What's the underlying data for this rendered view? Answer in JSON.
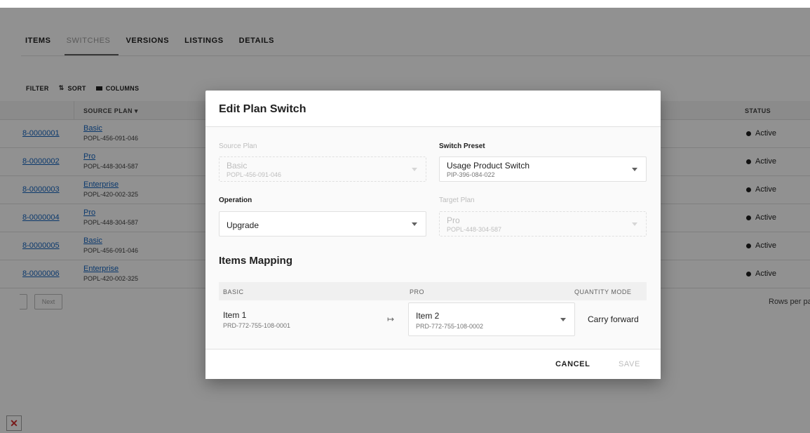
{
  "tabs": [
    {
      "label": "ITEMS",
      "active": false
    },
    {
      "label": "SWITCHES",
      "active": true
    },
    {
      "label": "VERSIONS",
      "active": false
    },
    {
      "label": "LISTINGS",
      "active": false
    },
    {
      "label": "DETAILS",
      "active": false
    }
  ],
  "toolbar": {
    "filter_label": "FILTER",
    "sort_label": "SORT",
    "sort_icon": "⇅",
    "columns_label": "COLUMNS"
  },
  "table": {
    "headers": {
      "source_plan": "SOURCE PLAN",
      "sort_arrow": "▾",
      "status": "STATUS"
    },
    "rows": [
      {
        "id": "8-0000001",
        "plan": "Basic",
        "plan_id": "POPL-456-091-046",
        "status": "Active"
      },
      {
        "id": "8-0000002",
        "plan": "Pro",
        "plan_id": "POPL-448-304-587",
        "status": "Active"
      },
      {
        "id": "8-0000003",
        "plan": "Enterprise",
        "plan_id": "POPL-420-002-325",
        "status": "Active"
      },
      {
        "id": "8-0000004",
        "plan": "Pro",
        "plan_id": "POPL-448-304-587",
        "status": "Active"
      },
      {
        "id": "8-0000005",
        "plan": "Basic",
        "plan_id": "POPL-456-091-046",
        "status": "Active"
      },
      {
        "id": "8-0000006",
        "plan": "Enterprise",
        "plan_id": "POPL-420-002-325",
        "status": "Active"
      }
    ]
  },
  "pagination": {
    "next_label": "Next",
    "rows_per_page": "Rows per pa"
  },
  "dialog": {
    "title": "Edit Plan Switch",
    "source_plan": {
      "label": "Source Plan",
      "value": "Basic",
      "sub": "POPL-456-091-046"
    },
    "switch_preset": {
      "label": "Switch Preset",
      "value": "Usage Product Switch",
      "sub": "PIP-396-084-022"
    },
    "operation": {
      "label": "Operation",
      "value": "Upgrade"
    },
    "target_plan": {
      "label": "Target Plan",
      "value": "Pro",
      "sub": "POPL-448-304-587"
    },
    "items_mapping": {
      "title": "Items Mapping",
      "headers": [
        "BASIC",
        "PRO",
        "QUANTITY MODE"
      ],
      "rows": [
        {
          "source_name": "Item 1",
          "source_id": "PRD-772-755-108-0001",
          "arrow": "↦",
          "target_name": "Item 2",
          "target_id": "PRD-772-755-108-0002",
          "mode": "Carry forward"
        }
      ]
    },
    "cancel_label": "CANCEL",
    "save_label": "SAVE"
  },
  "broken_image_glyph": "✕",
  "colors": {
    "link": "#1565c0",
    "scrim": "rgba(0,0,0,0.43)",
    "disabled": "#bdbdbd"
  }
}
